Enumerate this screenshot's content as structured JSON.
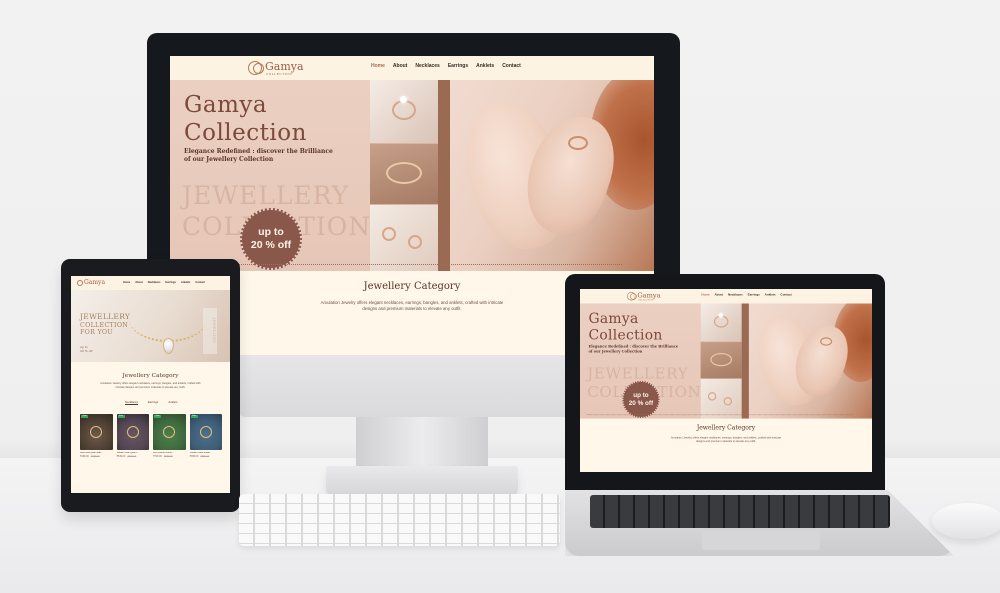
{
  "site": {
    "logo": {
      "name": "Gamya",
      "sub": "COLLECTION"
    },
    "menu": [
      "Home",
      "About",
      "Necklaces",
      "Earrings",
      "Anklets",
      "Contact"
    ],
    "hero": {
      "title_line1": "Gamya",
      "title_line2": "Collection",
      "tagline": "Elegance Redefined : discover the Brilliance of our Jewellery Collection",
      "ghost_line1": "JEWELLERY",
      "ghost_line2": "COLLECTION",
      "badge_line1": "up to",
      "badge_line2": "20 % off"
    },
    "category": {
      "title": "Jewellery Category",
      "description": "Amulation Jewelry offers elegant necklaces, earrings, bangles, and anklets, crafted with intricate designs and premium materials to elevate any outfit."
    }
  },
  "tablet": {
    "hero": {
      "line1": "JEWELLERY",
      "line2": "COLLECTION",
      "line3": "FOR YOU",
      "sub1": "up to",
      "sub2": "20 % off",
      "side": "JEWELLERY"
    },
    "tabs": [
      "Necklaces",
      "Earrings",
      "Anklets"
    ],
    "products": [
      {
        "name": "Gold tone green leaf...",
        "price": "₹499.00",
        "old": "₹699.00",
        "tag": "Sale"
      },
      {
        "name": "Golden finish green...",
        "price": "₹549.00",
        "old": "₹799.00",
        "tag": "Sale"
      },
      {
        "name": "Mint colored stone...",
        "price": "₹749.00",
        "old": "₹999.00",
        "tag": "Sale"
      },
      {
        "name": "Golden chain anklet...",
        "price": "₹399.00",
        "old": "₹599.00",
        "tag": "Sale"
      }
    ]
  }
}
